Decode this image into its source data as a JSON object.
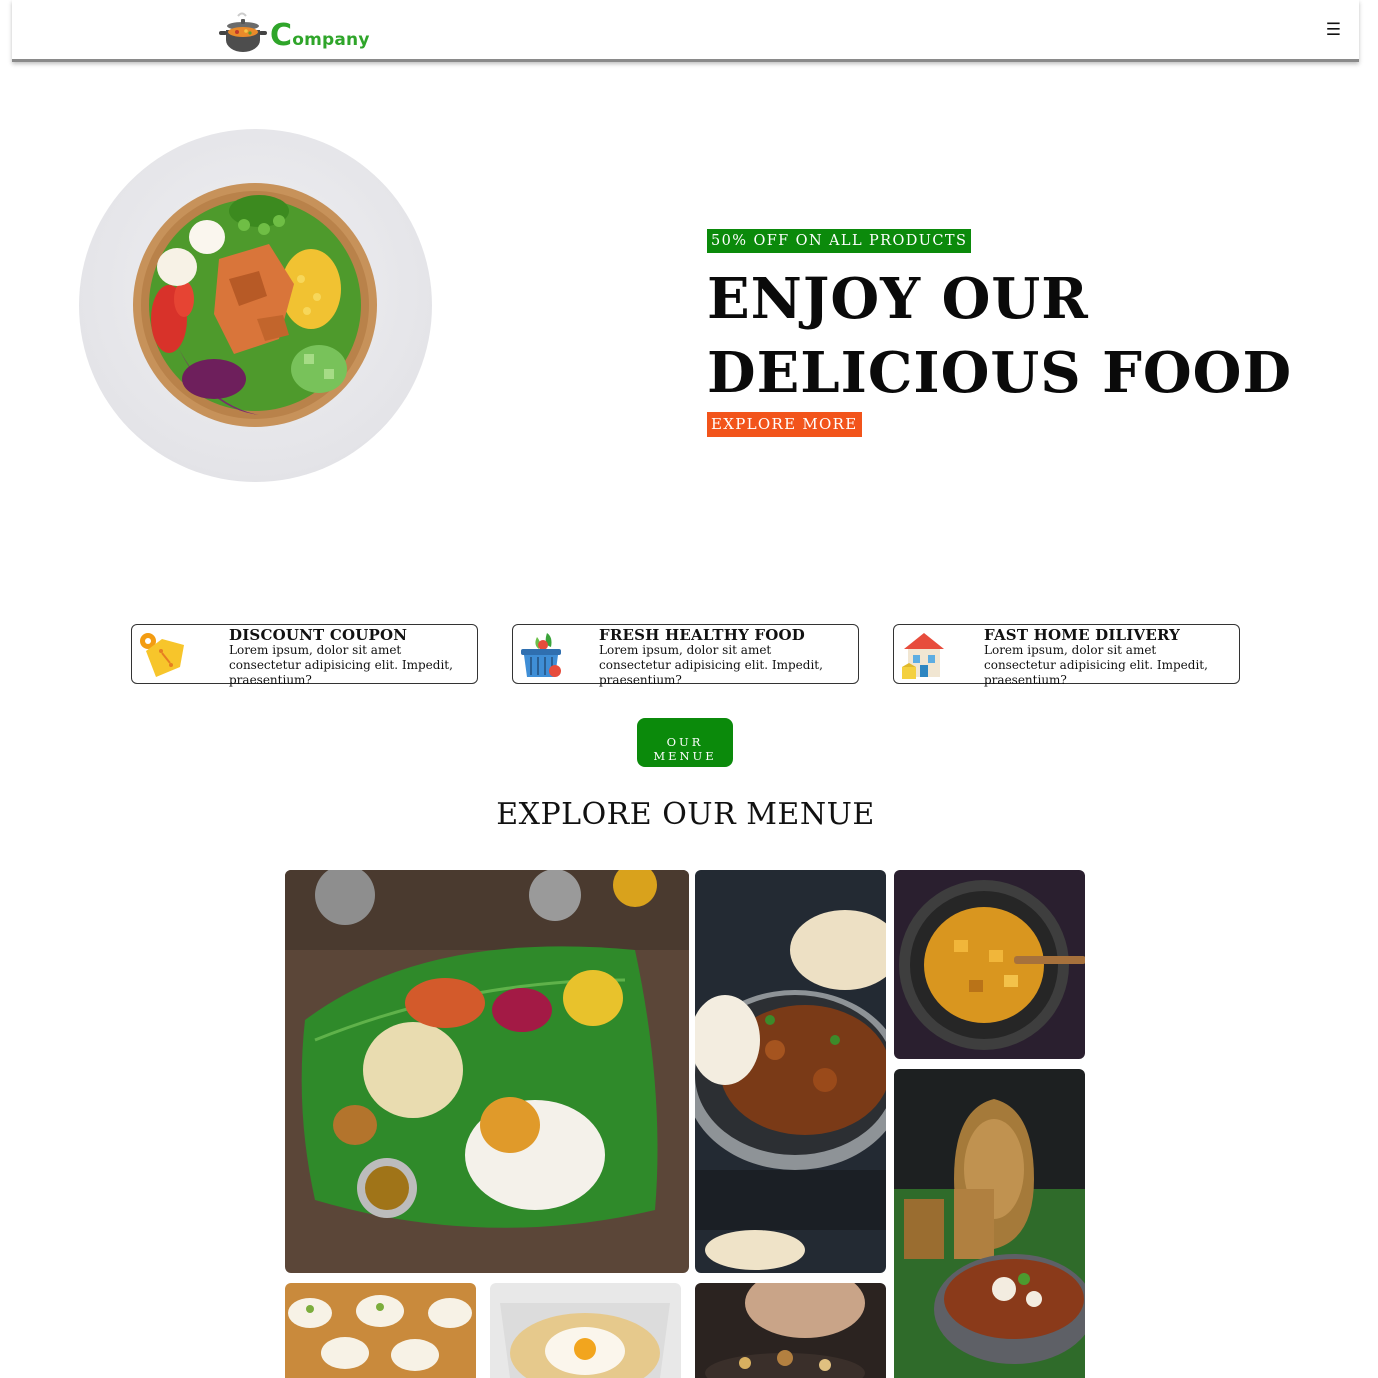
{
  "header": {
    "logo_letter": "C",
    "logo_rest": "ompany",
    "menu_icon": "☰"
  },
  "hero": {
    "badge": "50% OFF ON ALL PRODUCTS",
    "headline_line1": "ENJOY OUR",
    "headline_line2": "DELICIOUS FOOD",
    "cta": "EXPLORE MORE"
  },
  "features": [
    {
      "icon": "discount-tag-icon",
      "title": "DISCOUNT COUPON",
      "description": "Lorem ipsum, dolor sit amet consectetur adipisicing elit. Impedit, praesentium?"
    },
    {
      "icon": "grocery-basket-icon",
      "title": "FRESH HEALTHY FOOD",
      "description": "Lorem ipsum, dolor sit amet consectetur adipisicing elit. Impedit, praesentium?"
    },
    {
      "icon": "home-delivery-icon",
      "title": "FAST HOME DILIVERY",
      "description": "Lorem ipsum, dolor sit amet consectetur adipisicing elit. Impedit, praesentium?"
    }
  ],
  "menu_button": {
    "line1": "OUR",
    "line2": "MENUE"
  },
  "section_title": "EXPLORE OUR MENUE",
  "colors": {
    "brand_green": "#0b8a0b",
    "accent_orange": "#f2541b",
    "logo_green": "#2fa52a"
  }
}
